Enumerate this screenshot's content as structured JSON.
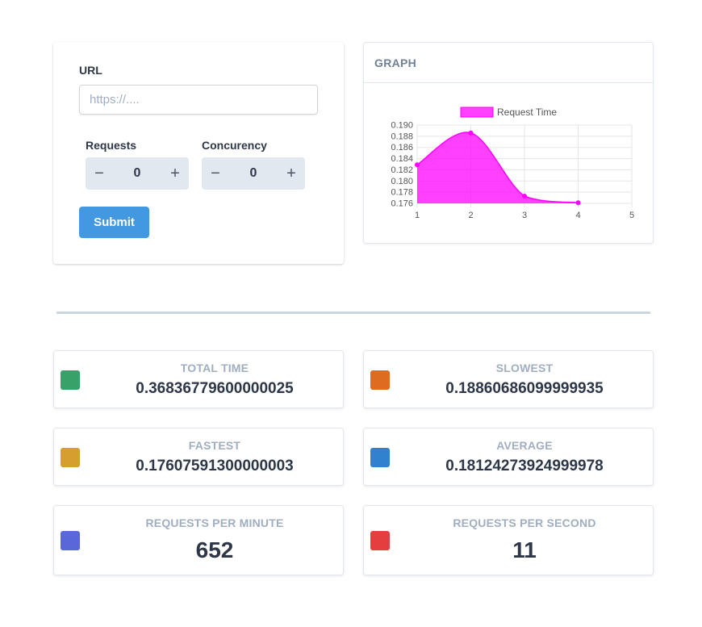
{
  "form": {
    "url_label": "URL",
    "url_placeholder": "https://....",
    "requests_label": "Requests",
    "requests_value": "0",
    "concurrency_label": "Concurency",
    "concurrency_value": "0",
    "minus_icon": "minus-icon",
    "plus_icon": "plus-icon",
    "submit_label": "Submit"
  },
  "graph": {
    "header": "GRAPH"
  },
  "chart_data": {
    "type": "area",
    "x": [
      1,
      2,
      3,
      4
    ],
    "x_ticks": [
      "1",
      "2",
      "3",
      "4",
      "5"
    ],
    "xlim": [
      1,
      5
    ],
    "y_ticks": [
      "0.190",
      "0.188",
      "0.186",
      "0.184",
      "0.182",
      "0.180",
      "0.178",
      "0.176"
    ],
    "ylim": [
      0.176,
      0.19
    ],
    "series": [
      {
        "name": "Request Time",
        "values": [
          0.1829,
          0.1886,
          0.1773,
          0.1761
        ],
        "color": "#ff00ff"
      }
    ],
    "legend": "top-center",
    "grid": true
  },
  "stats": {
    "total_time": {
      "label": "TOTAL TIME",
      "value": "0.36836779600000025",
      "color": "#38a169"
    },
    "slowest": {
      "label": "SLOWEST",
      "value": "0.18860686099999935",
      "color": "#dd6b20"
    },
    "fastest": {
      "label": "FASTEST",
      "value": "0.17607591300000003",
      "color": "#d69e2e"
    },
    "average": {
      "label": "AVERAGE",
      "value": "0.18124273924999978",
      "color": "#3182ce"
    },
    "rpm": {
      "label": "REQUESTS PER MINUTE",
      "value": "652",
      "color": "#5a67d8"
    },
    "rps": {
      "label": "REQUESTS PER SECOND",
      "value": "11",
      "color": "#e53e3e"
    }
  }
}
